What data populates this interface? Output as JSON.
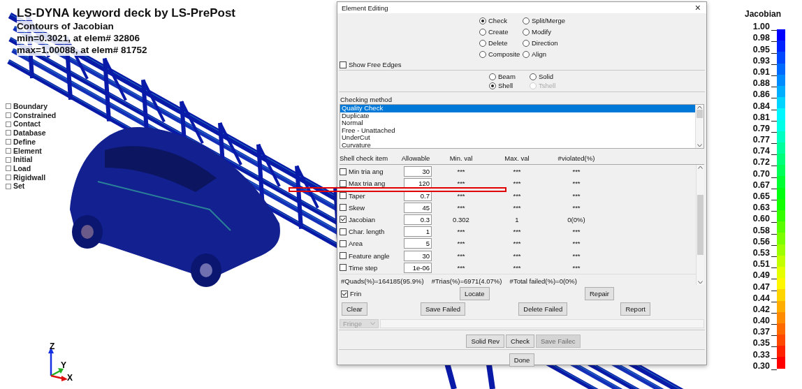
{
  "viewport": {
    "title": "LS-DYNA keyword deck by LS-PrePost",
    "subtitle": "Contours of Jacobian",
    "min_line": "min=0.3021, at elem# 32806",
    "max_line": "max=1.00088, at elem# 81752",
    "tree": [
      {
        "label": "Boundary"
      },
      {
        "label": "Constrained"
      },
      {
        "label": "Contact"
      },
      {
        "label": "Database"
      },
      {
        "label": "Define"
      },
      {
        "label": "Element"
      },
      {
        "label": "Initial"
      },
      {
        "label": "Load"
      },
      {
        "label": "Rigidwall"
      },
      {
        "label": "Set"
      }
    ],
    "axes": {
      "z": "Z",
      "y": "Y",
      "x": "X"
    }
  },
  "dialog": {
    "title": "Element Editing",
    "close": "×",
    "modes": [
      {
        "label": "Check",
        "selected": true
      },
      {
        "label": "Split/Merge",
        "selected": false
      },
      {
        "label": "Create",
        "selected": false
      },
      {
        "label": "Modify",
        "selected": false
      },
      {
        "label": "Delete",
        "selected": false
      },
      {
        "label": "Direction",
        "selected": false
      },
      {
        "label": "Composite",
        "selected": false
      },
      {
        "label": "Align",
        "selected": false
      }
    ],
    "show_free_edges": {
      "label": "Show Free Edges",
      "checked": false
    },
    "element_types": [
      {
        "label": "Beam",
        "selected": false,
        "disabled": false
      },
      {
        "label": "Solid",
        "selected": false,
        "disabled": false
      },
      {
        "label": "Shell",
        "selected": true,
        "disabled": false
      },
      {
        "label": "Tshell",
        "selected": false,
        "disabled": true
      }
    ],
    "checking_method": {
      "label": "Checking method",
      "items": [
        {
          "label": "Quality Check",
          "selected": true
        },
        {
          "label": "Duplicate",
          "selected": false
        },
        {
          "label": "Normal",
          "selected": false
        },
        {
          "label": "Free - Unattached",
          "selected": false
        },
        {
          "label": "UnderCut",
          "selected": false
        },
        {
          "label": "Curvature",
          "selected": false
        }
      ]
    },
    "check_table": {
      "columns": [
        "Shell check item",
        "Allowable",
        "Min. val",
        "Max. val",
        "#violated(%)"
      ],
      "rows": [
        {
          "item": "Min tria ang",
          "checked": false,
          "allowable": "30",
          "min": "***",
          "max": "***",
          "violated": "***"
        },
        {
          "item": "Max tria ang",
          "checked": false,
          "allowable": "120",
          "min": "***",
          "max": "***",
          "violated": "***"
        },
        {
          "item": "Taper",
          "checked": false,
          "allowable": "0.7",
          "min": "***",
          "max": "***",
          "violated": "***"
        },
        {
          "item": "Skew",
          "checked": false,
          "allowable": "45",
          "min": "***",
          "max": "***",
          "violated": "***"
        },
        {
          "item": "Jacobian",
          "checked": true,
          "allowable": "0.3",
          "min": "0.302",
          "max": "1",
          "violated": "0(0%)"
        },
        {
          "item": "Char. length",
          "checked": false,
          "allowable": "1",
          "min": "***",
          "max": "***",
          "violated": "***"
        },
        {
          "item": "Area",
          "checked": false,
          "allowable": "5",
          "min": "***",
          "max": "***",
          "violated": "***"
        },
        {
          "item": "Feature angle",
          "checked": false,
          "allowable": "30",
          "min": "***",
          "max": "***",
          "violated": "***"
        },
        {
          "item": "Time step",
          "checked": false,
          "allowable": "1e-06",
          "min": "***",
          "max": "***",
          "violated": "***"
        }
      ]
    },
    "summary": [
      "#Quads(%)=164185(95.9%)",
      "#Trias(%)=6971(4.07%)",
      "#Total failed(%)=0(0%)"
    ],
    "frin": {
      "label": "Frin",
      "checked": true
    },
    "buttons_row1": [
      {
        "label": "Locate"
      },
      {
        "label": "Repair"
      }
    ],
    "buttons_row2": [
      {
        "label": "Clear"
      },
      {
        "label": "Save Failed"
      },
      {
        "label": "Delete Failed"
      },
      {
        "label": "Report"
      }
    ],
    "fringe_select": {
      "value": "Fringe",
      "disabled": true
    },
    "buttons_row3": [
      {
        "label": "Solid Rev",
        "disabled": false
      },
      {
        "label": "Check",
        "disabled": false
      },
      {
        "label": "Save Failec",
        "disabled": true
      }
    ],
    "done": "Done"
  },
  "legend": {
    "title": "Jacobian",
    "labels": [
      "1.00",
      "0.98",
      "0.95",
      "0.93",
      "0.91",
      "0.88",
      "0.86",
      "0.84",
      "0.81",
      "0.79",
      "0.77",
      "0.74",
      "0.72",
      "0.70",
      "0.67",
      "0.65",
      "0.63",
      "0.60",
      "0.58",
      "0.56",
      "0.53",
      "0.51",
      "0.49",
      "0.47",
      "0.44",
      "0.42",
      "0.40",
      "0.37",
      "0.35",
      "0.33",
      "0.30"
    ]
  }
}
